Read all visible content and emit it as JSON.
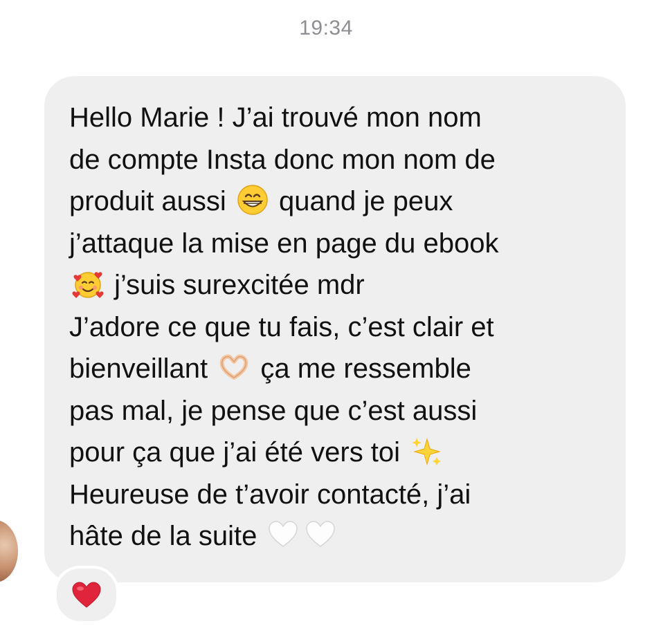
{
  "header": {
    "timestamp": "19:34"
  },
  "message": {
    "segments": [
      {
        "type": "text",
        "value": "Hello Marie ! J’ai trouvé mon nom\nde compte Insta donc mon nom de\nproduit aussi "
      },
      {
        "type": "emoji",
        "icon": "grinning-face-icon"
      },
      {
        "type": "text",
        "value": " quand je peux\nj’attaque la mise en page du ebook\n"
      },
      {
        "type": "emoji",
        "icon": "smiling-face-with-hearts-icon"
      },
      {
        "type": "text",
        "value": " j’suis surexcitée mdr\nJ’adore ce que tu fais, c’est clair et\nbienveillant "
      },
      {
        "type": "emoji",
        "icon": "heart-hands-icon"
      },
      {
        "type": "text",
        "value": " ça me ressemble\npas mal, je pense que c’est aussi\npour ça que j’ai été vers toi "
      },
      {
        "type": "emoji",
        "icon": "sparkles-icon"
      },
      {
        "type": "text",
        "value": "\nHeureuse de t’avoir contacté, j’ai\nhâte de la suite "
      },
      {
        "type": "emoji",
        "icon": "white-heart-icon"
      },
      {
        "type": "emoji",
        "icon": "white-heart-icon"
      }
    ]
  },
  "reaction": {
    "icon": "red-heart-icon",
    "color": "#e0243b"
  },
  "colors": {
    "bubble": "#efefef",
    "timestamp": "#8e8e93",
    "text": "#111111"
  }
}
